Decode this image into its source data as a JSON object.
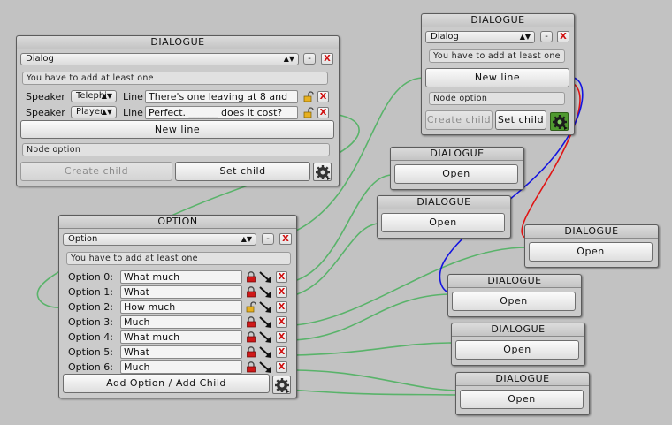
{
  "colors": {
    "wire_green": "#59b36a",
    "wire_red": "#e01414",
    "wire_blue": "#1414e0",
    "canvas": "#c2c2c2"
  },
  "icons": {
    "gear": "gear-icon",
    "lock": "lock-icon",
    "unlock": "unlock-icon",
    "arrow": "arrow-link-icon",
    "close": "close-icon"
  },
  "dialogue_main": {
    "title": "DIALOGUE",
    "type_value": "Dialog",
    "minus": "-",
    "close": "X",
    "info": "You have to add at least one",
    "lines": [
      {
        "speaker_label": "Speaker",
        "speaker": "Telephi",
        "line_label": "Line",
        "text": "There's one leaving at 8 and"
      },
      {
        "speaker_label": "Speaker",
        "speaker": "Player",
        "line_label": "Line",
        "text": "Perfect. ______ does it cost?"
      }
    ],
    "new_line": "New line",
    "node_option": "Node option",
    "create_child": "Create child",
    "set_child": "Set child"
  },
  "dialogue_top_right": {
    "title": "DIALOGUE",
    "type_value": "Dialog",
    "minus": "-",
    "close": "X",
    "info": "You have to add at least one",
    "new_line": "New line",
    "node_option": "Node option",
    "create_child": "Create child",
    "set_child": "Set child"
  },
  "option_node": {
    "title": "OPTION",
    "type_value": "Option",
    "minus": "-",
    "close": "X",
    "info": "You have to add at least one",
    "options": [
      {
        "label": "Option 0:",
        "value": "What much",
        "locked": true
      },
      {
        "label": "Option 1:",
        "value": "What",
        "locked": true
      },
      {
        "label": "Option 2:",
        "value": "How much",
        "locked": false
      },
      {
        "label": "Option 3:",
        "value": "Much",
        "locked": true
      },
      {
        "label": "Option 4:",
        "value": "What much",
        "locked": true
      },
      {
        "label": "Option 5:",
        "value": "What",
        "locked": true
      },
      {
        "label": "Option 6:",
        "value": "Much",
        "locked": true
      }
    ],
    "add_option": "Add Option / Add Child"
  },
  "small_dialogues": [
    {
      "title": "DIALOGUE",
      "button": "Open"
    },
    {
      "title": "DIALOGUE",
      "button": "Open"
    },
    {
      "title": "DIALOGUE",
      "button": "Open"
    },
    {
      "title": "DIALOGUE",
      "button": "Open"
    },
    {
      "title": "DIALOGUE",
      "button": "Open"
    },
    {
      "title": "DIALOGUE",
      "button": "Open"
    }
  ]
}
